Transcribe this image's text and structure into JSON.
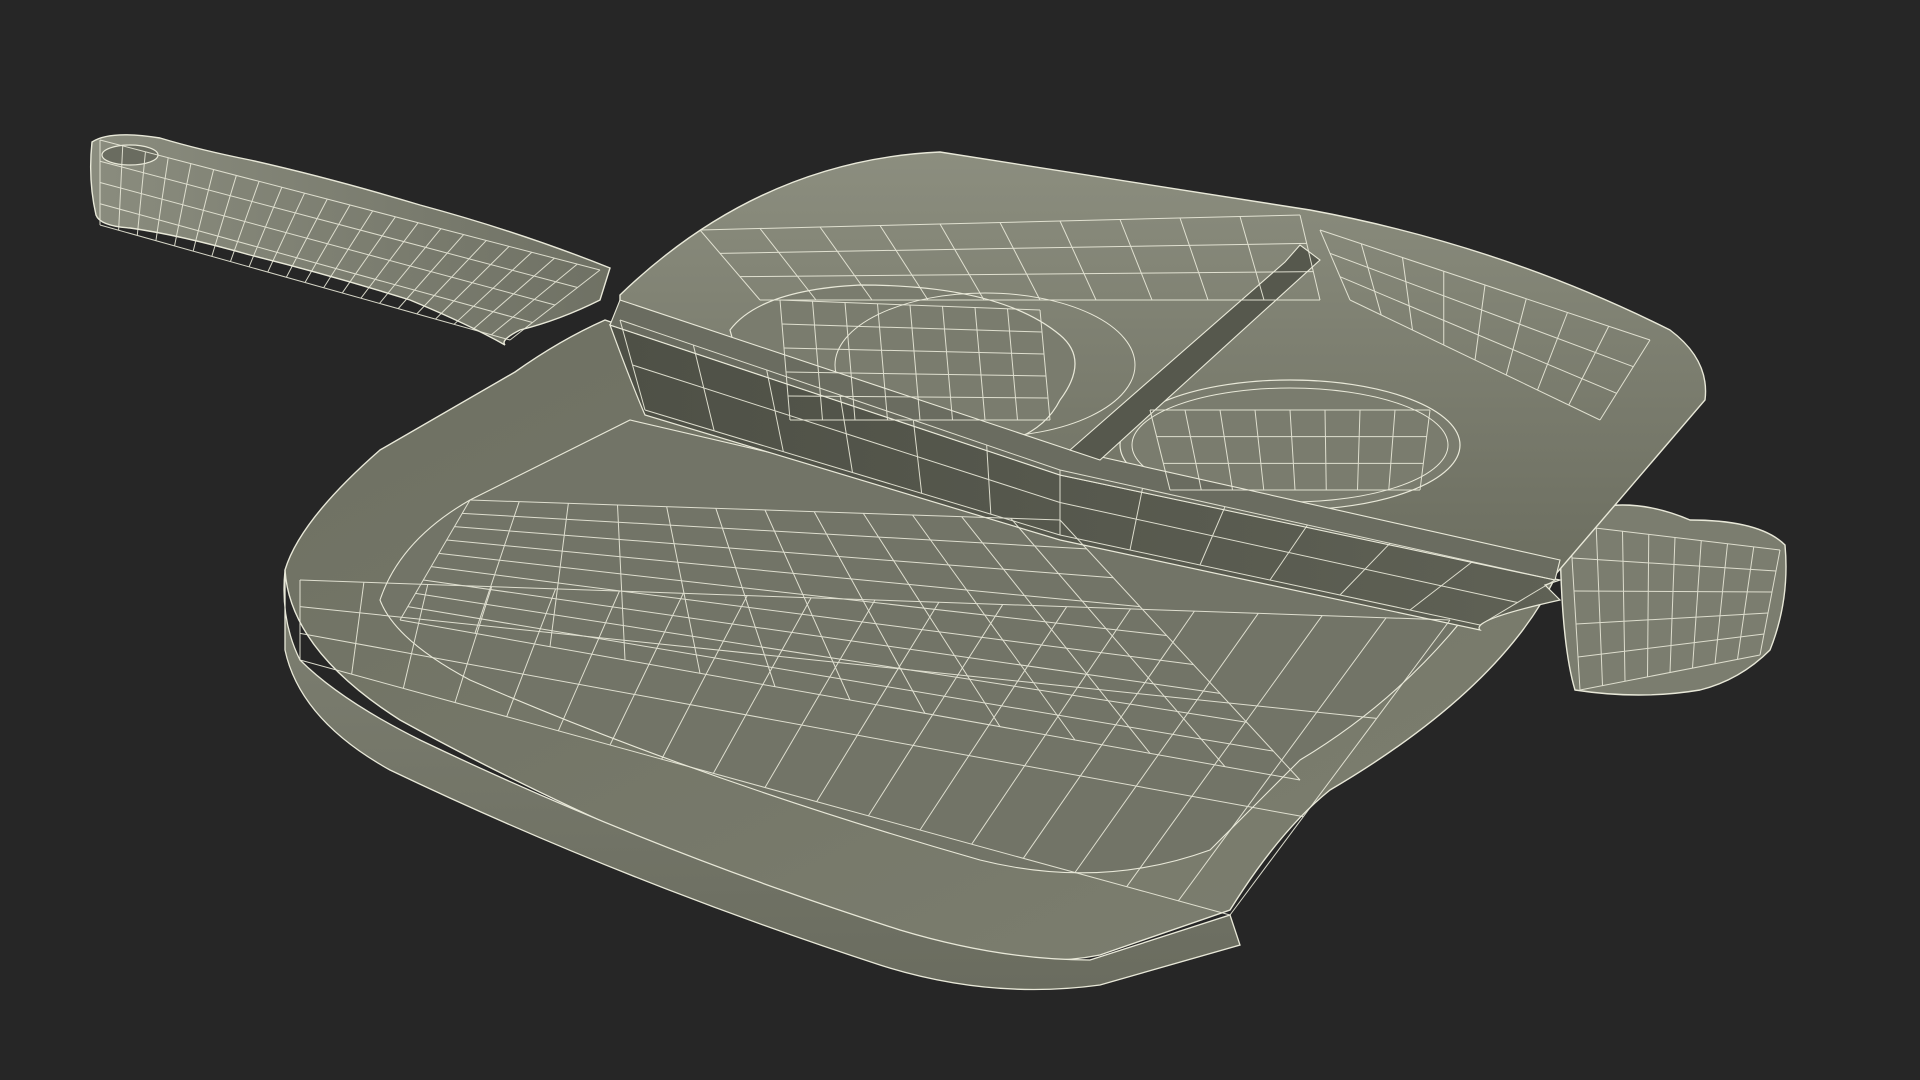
{
  "viewport": {
    "background": "#262626"
  },
  "model": {
    "subject": "pan-wireframe",
    "colors": {
      "surface_light": "#8a8c7d",
      "surface_mid": "#787a6b",
      "surface_dark": "#5a5c50",
      "wire": "#e8e8d8"
    }
  }
}
